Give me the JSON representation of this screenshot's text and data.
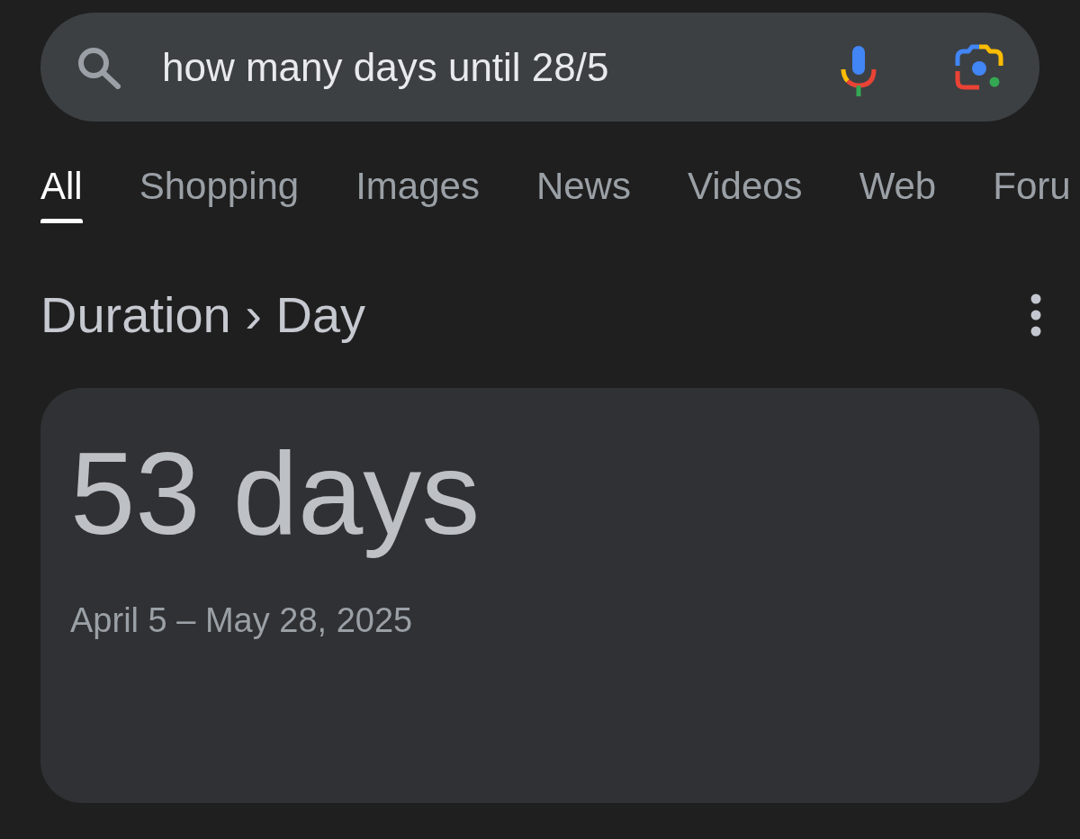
{
  "search": {
    "value": "how many days until 28/5"
  },
  "tabs": [
    {
      "label": "All",
      "selected": true
    },
    {
      "label": "Shopping",
      "selected": false
    },
    {
      "label": "Images",
      "selected": false
    },
    {
      "label": "News",
      "selected": false
    },
    {
      "label": "Videos",
      "selected": false
    },
    {
      "label": "Web",
      "selected": false
    },
    {
      "label": "Foru",
      "selected": false
    }
  ],
  "result": {
    "breadcrumb": "Duration › Day",
    "answer": "53 days",
    "date_range": "April 5 – May 28, 2025"
  }
}
